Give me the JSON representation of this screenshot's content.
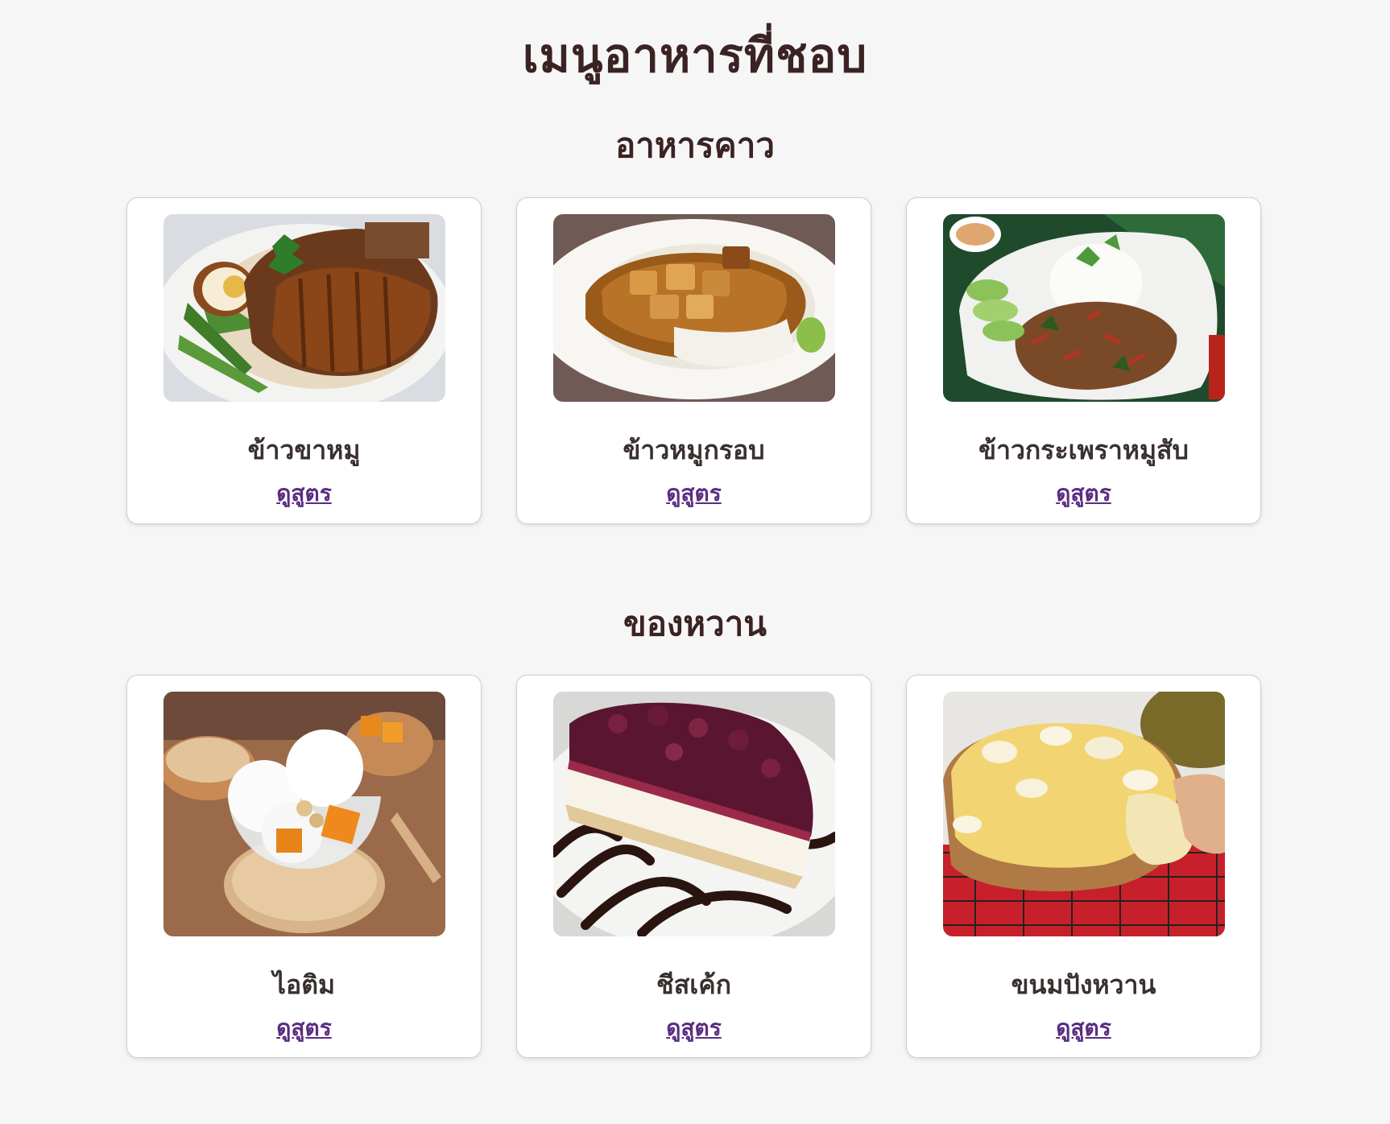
{
  "page": {
    "title": "เมนูอาหารที่ชอบ"
  },
  "sections": [
    {
      "title": "อาหารคาว",
      "items": [
        {
          "name": "ข้าวขาหมู",
          "link": "ดูสูตร",
          "image": "braised-pork-leg-rice-photo"
        },
        {
          "name": "ข้าวหมูกรอบ",
          "link": "ดูสูตร",
          "image": "crispy-pork-rice-photo"
        },
        {
          "name": "ข้าวกระเพราหมูสับ",
          "link": "ดูสูตร",
          "image": "basil-minced-pork-rice-photo"
        }
      ]
    },
    {
      "title": "ของหวาน",
      "items": [
        {
          "name": "ไอติม",
          "link": "ดูสูตร",
          "image": "ice-cream-photo"
        },
        {
          "name": "ชีสเค้ก",
          "link": "ดูสูตร",
          "image": "cheesecake-photo"
        },
        {
          "name": "ขนมปังหวาน",
          "link": "ดูสูตร",
          "image": "durian-sweet-bread-photo"
        }
      ]
    }
  ],
  "colors": {
    "background": "#f6f6f6",
    "heading": "#3b2323",
    "link": "#5a2d82",
    "card_border": "#cfcfcf"
  }
}
